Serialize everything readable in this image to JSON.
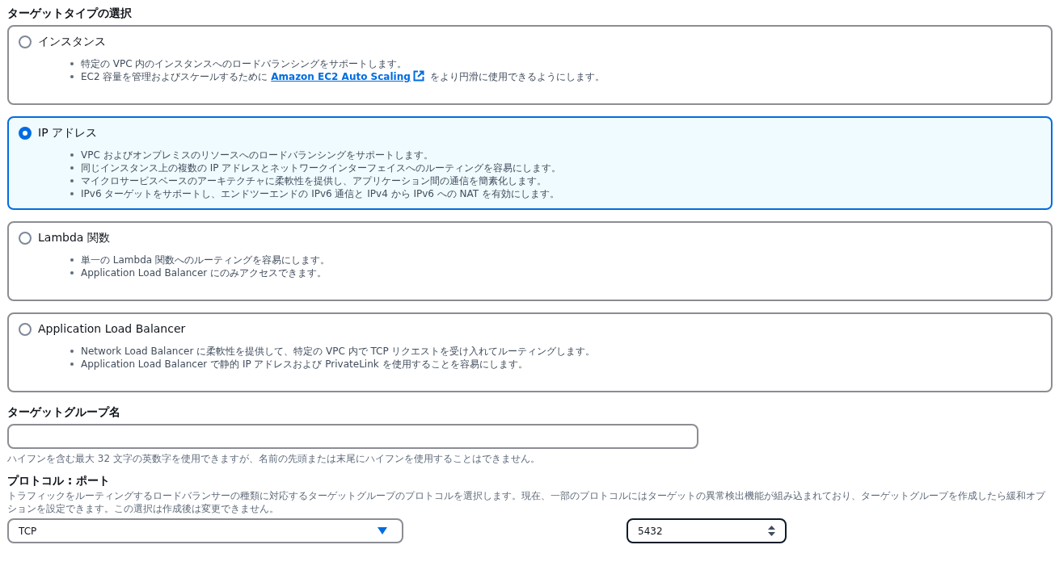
{
  "target_type": {
    "heading": "ターゲットタイプの選択",
    "options": [
      {
        "label": "インスタンス",
        "selected": false,
        "bullets": [
          {
            "text": "特定の VPC 内のインスタンスへのロードバランシングをサポートします。"
          },
          {
            "text": "EC2 容量を管理およびスケールするために",
            "link": "Amazon EC2 Auto Scaling",
            "after": "をより円滑に使用できるようにします。"
          }
        ]
      },
      {
        "label": "IP アドレス",
        "selected": true,
        "bullets": [
          {
            "text": "VPC およびオンプレミスのリソースへのロードバランシングをサポートします。"
          },
          {
            "text": "同じインスタンス上の複数の IP アドレスとネットワークインターフェイスへのルーティングを容易にします。"
          },
          {
            "text": "マイクロサービスベースのアーキテクチャに柔軟性を提供し、アプリケーション間の通信を簡素化します。"
          },
          {
            "text": "IPv6 ターゲットをサポートし、エンドツーエンドの IPv6 通信と IPv4 から IPv6 への NAT を有効にします。"
          }
        ]
      },
      {
        "label": "Lambda 関数",
        "selected": false,
        "bullets": [
          {
            "text": "単一の Lambda 関数へのルーティングを容易にします。"
          },
          {
            "text": "Application Load Balancer にのみアクセスできます。"
          }
        ]
      },
      {
        "label": "Application Load Balancer",
        "selected": false,
        "bullets": [
          {
            "text": "Network Load Balancer に柔軟性を提供して、特定の VPC 内で TCP リクエストを受け入れてルーティングします。"
          },
          {
            "text": "Application Load Balancer で静的 IP アドレスおよび PrivateLink を使用することを容易にします。"
          }
        ]
      }
    ]
  },
  "target_group_name": {
    "label": "ターゲットグループ名",
    "hint": "ハイフンを含む最大 32 文字の英数字を使用できますが、名前の先頭または末尾にハイフンを使用することはできません。"
  },
  "protocol_port": {
    "label": "プロトコル : ポート",
    "description": "トラフィックをルーティングするロードバランサーの種類に対応するターゲットグループのプロトコルを選択します。現在、一部のプロトコルにはターゲットの異常検出機能が組み込まれており、ターゲットグループを作成したら緩和オプションを設定できます。この選択は作成後は変更できません。",
    "protocol": "TCP",
    "port": "5432"
  }
}
